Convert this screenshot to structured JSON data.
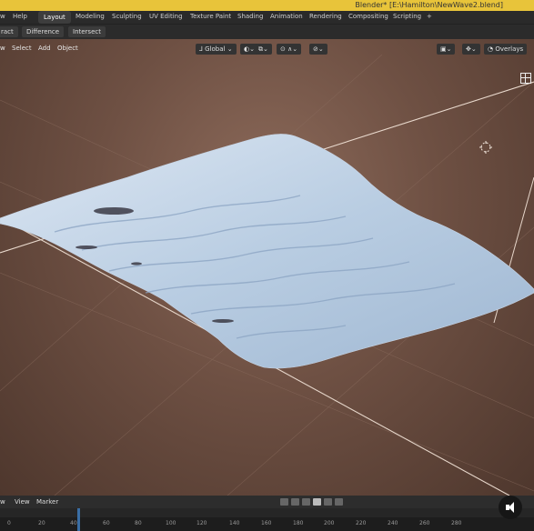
{
  "window": {
    "title": "Blender* [E:\\Hamilton\\NewWave2.blend]"
  },
  "menu": {
    "items": [
      "w",
      "Help",
      "Layout",
      "Modeling",
      "Sculpting",
      "UV Editing",
      "Texture Paint",
      "Shading",
      "Animation",
      "Rendering",
      "Compositing",
      "Scripting",
      "+"
    ],
    "active": "Layout"
  },
  "boolean_row": {
    "items": [
      "ract",
      "Difference",
      "Intersect"
    ]
  },
  "viewport": {
    "header_menu": [
      "w",
      "Select",
      "Add",
      "Object"
    ],
    "transform_orientation": "Global",
    "overlays_label": "Overlays"
  },
  "timeline": {
    "menu": [
      "w",
      "View",
      "Marker"
    ],
    "ruler_ticks": [
      "0",
      "20",
      "40",
      "60",
      "80",
      "100",
      "120",
      "140",
      "160",
      "180",
      "200",
      "220",
      "240",
      "260",
      "280"
    ]
  }
}
